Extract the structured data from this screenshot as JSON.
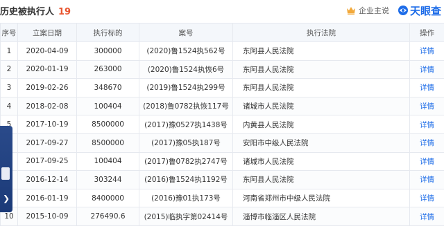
{
  "header": {
    "title": "历史被执行人",
    "count": "19",
    "owner_link": "企业主说",
    "logo_text": "天眼查",
    "accent": "#e8542e",
    "brand_color": "#1d6ce8"
  },
  "table": {
    "columns": [
      "序号",
      "立案日期",
      "执行标的",
      "案号",
      "执行法院",
      "操作"
    ],
    "rows": [
      {
        "idx": "1",
        "date": "2020-04-09",
        "amount": "300000",
        "case": "(2020)鲁1524执562号",
        "court": "东阿县人民法院",
        "action": "详情"
      },
      {
        "idx": "2",
        "date": "2020-01-19",
        "amount": "263000",
        "case": "(2020)鲁1524执恢6号",
        "court": "东阿县人民法院",
        "action": "详情"
      },
      {
        "idx": "3",
        "date": "2019-02-26",
        "amount": "348670",
        "case": "(2019)鲁1524执299号",
        "court": "东阿县人民法院",
        "action": "详情"
      },
      {
        "idx": "4",
        "date": "2018-02-08",
        "amount": "100404",
        "case": "(2018)鲁0782执恢117号",
        "court": "诸城市人民法院",
        "action": "详情"
      },
      {
        "idx": "5",
        "date": "2017-10-19",
        "amount": "8500000",
        "case": "(2017)豫0527执1438号",
        "court": "内黄县人民法院",
        "action": "详情"
      },
      {
        "idx": "6",
        "date": "2017-09-27",
        "amount": "8500000",
        "case": "(2017)豫05执187号",
        "court": "安阳市中级人民法院",
        "action": "详情"
      },
      {
        "idx": "7",
        "date": "2017-09-25",
        "amount": "100404",
        "case": "(2017)鲁0782执2747号",
        "court": "诸城市人民法院",
        "action": "详情"
      },
      {
        "idx": "8",
        "date": "2016-12-14",
        "amount": "303244",
        "case": "(2016)鲁1524执1192号",
        "court": "东阿县人民法院",
        "action": "详情"
      },
      {
        "idx": "9",
        "date": "2016-01-19",
        "amount": "8400000",
        "case": "(2016)豫01执173号",
        "court": "河南省郑州市中级人民法院",
        "action": "详情"
      },
      {
        "idx": "10",
        "date": "2015-10-09",
        "amount": "276490.6",
        "case": "(2015)临执字第02414号",
        "court": "淄博市临淄区人民法院",
        "action": "详情"
      }
    ]
  }
}
